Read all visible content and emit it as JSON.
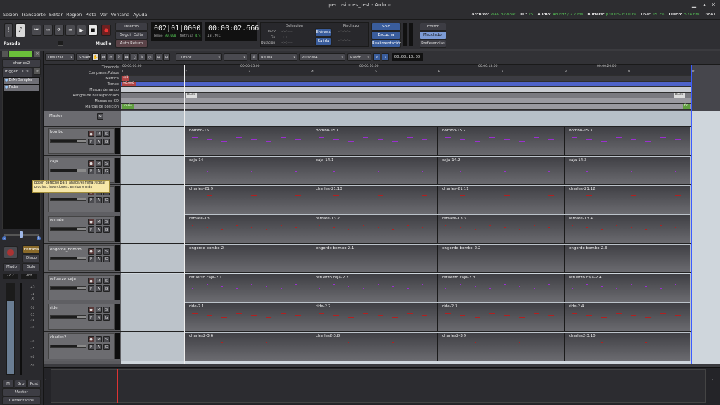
{
  "window": {
    "title": "percusiones_test - Ardour"
  },
  "menu": [
    "Sesión",
    "Transporte",
    "Editar",
    "Región",
    "Pista",
    "Ver",
    "Ventana",
    "Ayuda"
  ],
  "status": {
    "archivo_k": "Archivo:",
    "archivo_v": "WAV 32-float",
    "tc_k": "TC:",
    "tc_v": "25",
    "audio_k": "Audio:",
    "audio_v": "48 kHz / 2.7 ms",
    "buffers_k": "Buffers:",
    "buffers_v": "p:100% c:100%",
    "dsp_k": "DSP:",
    "dsp_v": "15.2%",
    "disco_k": "Disco:",
    "disco_v": ">24 hrs",
    "time": "19:41"
  },
  "transport": {
    "interno": "Interno",
    "seguir": "Seguir Edits",
    "autoreturn": "Auto Return",
    "bbt": "002|01|0000",
    "tempo_k": "Tempo",
    "tempo_v": "90.000",
    "metrica_k": "Métrica",
    "metrica_v": "4/4",
    "timecode": "00:00:02.666",
    "intmtc": "INT/MTC",
    "parado": "Parado",
    "muelle": "Muelle"
  },
  "selection": {
    "title": "Selección",
    "inicio": "Inicio",
    "fin": "Fin",
    "duracion": "Duración",
    "blank": "--:--:--:--",
    "entrada": "Entrada",
    "salida": "Salida",
    "pinchazo": "Pinchazo"
  },
  "monitor": {
    "solo": "Solo",
    "escucha": "Escucha",
    "realim": "Realimentación"
  },
  "windows": {
    "editor": "Editor",
    "mezclador": "Mezclador",
    "prefs": "Preferencias"
  },
  "edit_toolbar": {
    "mode": "Deslizar",
    "smart": "Smart",
    "cursor": "Cursor",
    "rejilla": "Rejilla",
    "pulsos": "Pulsos/4",
    "raton": "Ratón",
    "nudge": "00:00:10:00"
  },
  "rulers": {
    "labels": [
      "Timecode",
      "Compases:Pulsos",
      "Métrica",
      "Tempo",
      "Marcas de rango",
      "Rangos de bucle/pinchazo",
      "Marcas de CD",
      "Marcas de posición"
    ],
    "metrica": "4/4",
    "tempo": "90,000",
    "bucle": "Bucle",
    "inicio": "inicio",
    "fin": "fin",
    "tc": [
      "00:00:00:00",
      "00:00:05:00",
      "00:00:10:00",
      "00:00:15:00",
      "00:00:20:00"
    ],
    "bars": [
      "1",
      "2",
      "3",
      "4",
      "5",
      "6",
      "7",
      "8",
      "9",
      "10"
    ]
  },
  "master": {
    "name": "Master",
    "m": "M"
  },
  "strip": {
    "name": "charles2",
    "trigger": "Trigger ...D:1 (K)",
    "plugin": "DrMr Sampler",
    "fader": "Fader",
    "entrada": "Entrada",
    "disco": "Disco",
    "mudo": "Mudo",
    "solo": "Solo",
    "gain": "-2.2",
    "peak": "-inf",
    "scale": [
      "+3",
      "-3",
      "-5",
      "-10",
      "-15",
      "-18",
      "-20",
      "-30",
      "-35",
      "-40",
      "-50"
    ],
    "m": "M",
    "grp": "Grp",
    "post": "Post",
    "master": "Master",
    "comentarios": "Comentarios"
  },
  "tooltip": "Botón derecho para añadir/eliminar/editar plugins, inserciones, envíos y más",
  "track_btn": {
    "m": "M",
    "s": "S",
    "p": "P",
    "a": "A",
    "g": "G"
  },
  "tracks": [
    {
      "name": "bombo",
      "regions": [
        "bombo-15",
        "bombo-15.1",
        "bombo-15.2",
        "bombo-15.3"
      ],
      "color": "#9b2fd0"
    },
    {
      "name": "caja",
      "regions": [
        "caja-14",
        "caja-14.1",
        "caja-14.2",
        "caja-14.3"
      ],
      "color": "#9b2fd0"
    },
    {
      "name": "charles",
      "regions": [
        "charles-21.9",
        "charles-21.10",
        "charles-21.11",
        "charles-21.12"
      ],
      "color": "#b22020"
    },
    {
      "name": "remate",
      "regions": [
        "remate-13.1",
        "remate-13.2",
        "remate-13.3",
        "remate-13.4"
      ],
      "color": "#b22020"
    },
    {
      "name": "engorde_bombo",
      "regions": [
        "engorde bombo-2",
        "engorde bombo-2.1",
        "engorde bombo-2.2",
        "engorde bombo-2.3"
      ],
      "color": "#9b2fd0"
    },
    {
      "name": "refuerzo_caja",
      "regions": [
        "refuerzo caja-2.1",
        "refuerzo caja-2.2",
        "refuerzo caja-2.3",
        "refuerzo caja-2.4"
      ],
      "color": "#9b2fd0"
    },
    {
      "name": "ride",
      "regions": [
        "ride-2.1",
        "ride-2.2",
        "ride-2.3",
        "ride-2.4"
      ],
      "color": "#b22020"
    },
    {
      "name": "charles2",
      "regions": [
        "charles2-3.6",
        "charles2-3.8",
        "charles2-3.9",
        "charles2-3.10"
      ],
      "color": "#b22020"
    }
  ]
}
